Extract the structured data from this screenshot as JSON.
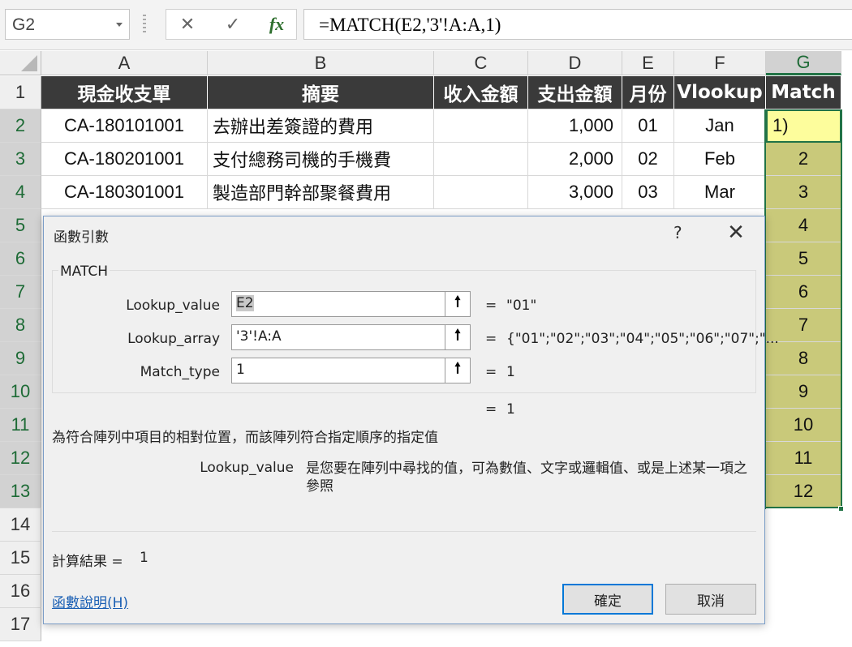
{
  "formula_bar": {
    "name_box": "G2",
    "cancel_icon": "✕",
    "enter_icon": "✓",
    "fx_icon": "fx",
    "formula": "=MATCH(E2,'3'!A:A,1)"
  },
  "columns": [
    "A",
    "B",
    "C",
    "D",
    "E",
    "F",
    "G"
  ],
  "rows": [
    "1",
    "2",
    "3",
    "4",
    "5",
    "6",
    "7",
    "8",
    "9",
    "10",
    "11",
    "12",
    "13",
    "14",
    "15",
    "16",
    "17"
  ],
  "header_row": {
    "A": "現金收支單",
    "B": "摘要",
    "C": "收入金額",
    "D": "支出金額",
    "E": "月份",
    "F": "Vlookup",
    "G": "Match"
  },
  "data_rows": [
    {
      "A": "CA-180101001",
      "B": "去辦出差簽證的費用",
      "C": "",
      "D": "1,000",
      "E": "01",
      "F": "Jan",
      "G": "1)"
    },
    {
      "A": "CA-180201001",
      "B": "支付總務司機的手機費",
      "C": "",
      "D": "2,000",
      "E": "02",
      "F": "Feb",
      "G": "2"
    },
    {
      "A": "CA-180301001",
      "B": "製造部門幹部聚餐費用",
      "C": "",
      "D": "3,000",
      "E": "03",
      "F": "Mar",
      "G": "3"
    }
  ],
  "g_column_values": [
    "4",
    "5",
    "6",
    "7",
    "8",
    "9",
    "10",
    "11",
    "12"
  ],
  "dialog": {
    "title": "函數引數",
    "help_icon": "?",
    "close_icon": "✕",
    "group_title": "MATCH",
    "args": [
      {
        "label": "Lookup_value",
        "value": "E2",
        "result": "\"01\""
      },
      {
        "label": "Lookup_array",
        "value": "'3'!A:A",
        "result": "{\"01\";\"02\";\"03\";\"04\";\"05\";\"06\";\"07\";\"..."
      },
      {
        "label": "Match_type",
        "value": "1",
        "result": "1"
      }
    ],
    "ref_icon": "🠕",
    "equals": "=",
    "formula_result": "1",
    "description": "為符合陣列中項目的相對位置，而該陣列符合指定順序的指定值",
    "arg_help_name": "Lookup_value",
    "arg_help_text": "是您要在陣列中尋找的值，可為數值、文字或邏輯值、或是上述某一項之參照",
    "calc_label": "計算結果 =",
    "calc_value": "1",
    "help_link": "函數說明(H)",
    "ok": "確定",
    "cancel": "取消"
  }
}
